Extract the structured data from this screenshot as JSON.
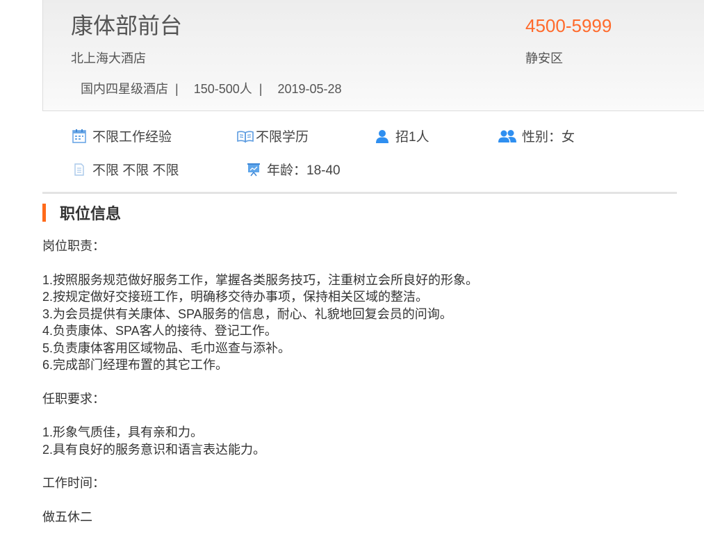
{
  "job": {
    "title": "康体部前台",
    "company": "北上海大酒店",
    "hotel_type": "国内四星级酒店",
    "company_size": "150-500人",
    "date": "2019-05-28",
    "separator": "|",
    "salary": "4500-5999",
    "district": "静安区"
  },
  "requirements": {
    "experience": "不限工作经验",
    "education": "不限学历",
    "headcount": "招1人",
    "gender": "性别：女",
    "misc": "不限 不限 不限",
    "age": "年龄：18-40"
  },
  "icons": {
    "experience": "calendar-icon",
    "education": "open-book-icon",
    "headcount": "person-icon",
    "gender": "two-people-icon",
    "misc": "document-icon",
    "age": "presentation-board-icon",
    "accent_color": "#2f8ff0",
    "light_color": "#9cc6ee"
  },
  "colors": {
    "salary": "#ff6a2b",
    "section_bar": "#ff6a1a"
  },
  "section": {
    "title": "职位信息"
  },
  "content": {
    "duties_heading": "岗位职责：",
    "duties": [
      "1.按照服务规范做好服务工作，掌握各类服务技巧，注重树立会所良好的形象。",
      "2.按规定做好交接班工作，明确移交待办事项，保持相关区域的整洁。",
      "3.为会员提供有关康体、SPA服务的信息，耐心、礼貌地回复会员的问询。",
      "4.负责康体、SPA客人的接待、登记工作。",
      "5.负责康体客用区域物品、毛巾巡查与添补。",
      "6.完成部门经理布置的其它工作。"
    ],
    "qualifications_heading": "任职要求：",
    "qualifications": [
      "1.形象气质佳，具有亲和力。",
      "2.具有良好的服务意识和语言表达能力。"
    ],
    "hours_heading": "工作时间：",
    "hours": "做五休二"
  }
}
